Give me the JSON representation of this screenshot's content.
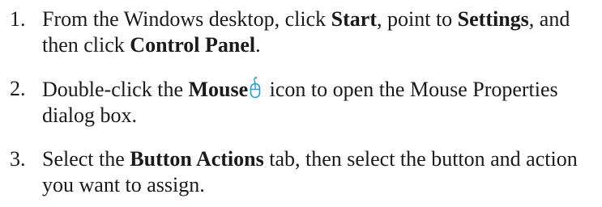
{
  "steps": [
    {
      "number": "1.",
      "segments": [
        {
          "text": "From the Windows desktop, click ",
          "bold": false
        },
        {
          "text": "Start",
          "bold": true
        },
        {
          "text": ", point to ",
          "bold": false
        },
        {
          "text": "Settings",
          "bold": true
        },
        {
          "text": ", and then click ",
          "bold": false
        },
        {
          "text": "Control Panel",
          "bold": true
        },
        {
          "text": ".",
          "bold": false
        }
      ]
    },
    {
      "number": "2.",
      "segments": [
        {
          "text": "Double-click the ",
          "bold": false
        },
        {
          "text": "Mouse",
          "bold": true
        },
        {
          "icon": "mouse-icon"
        },
        {
          "text": " icon to open the Mouse Properties dialog box.",
          "bold": false
        }
      ]
    },
    {
      "number": "3.",
      "segments": [
        {
          "text": "Select the ",
          "bold": false
        },
        {
          "text": "Button Actions",
          "bold": true
        },
        {
          "text": " tab, then select the button and action you want to assign.",
          "bold": false
        }
      ]
    }
  ],
  "colors": {
    "text": "#1a1a1a",
    "icon_accent": "#1ea0d6"
  }
}
